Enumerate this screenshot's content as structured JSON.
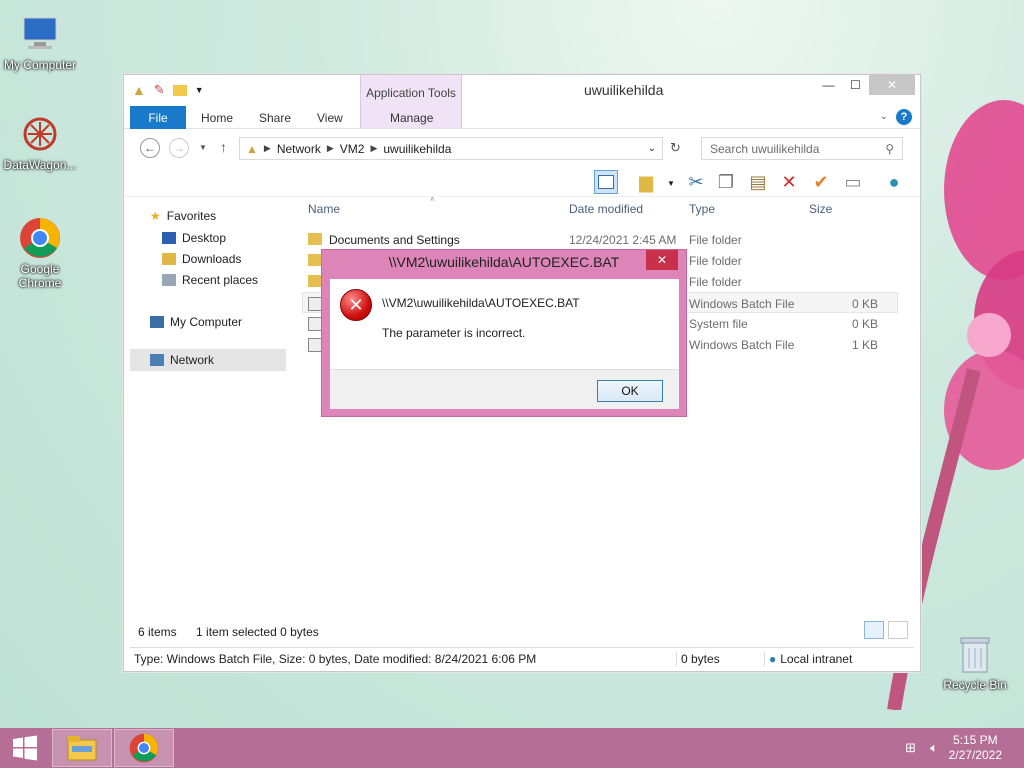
{
  "desktop": {
    "icons": [
      {
        "label": "My Computer"
      },
      {
        "label": "DataWagon..."
      },
      {
        "label": "Google Chrome"
      },
      {
        "label": "Recycle Bin"
      }
    ]
  },
  "window": {
    "title": "uwuilikehilda",
    "app_tools_label": "Application Tools",
    "tabs": {
      "file": "File",
      "home": "Home",
      "share": "Share",
      "view": "View",
      "manage": "Manage"
    },
    "address": {
      "crumbs": [
        "Network",
        "VM2",
        "uwuilikehilda"
      ]
    },
    "search_placeholder": "Search uwuilikehilda",
    "nav": {
      "favorites": "Favorites",
      "desktop": "Desktop",
      "downloads": "Downloads",
      "recent": "Recent places",
      "my_computer": "My Computer",
      "network": "Network"
    },
    "columns": {
      "name": "Name",
      "date": "Date modified",
      "type": "Type",
      "size": "Size"
    },
    "rows": [
      {
        "name": "Documents and Settings",
        "date": "12/24/2021 2:45 AM",
        "type": "File folder",
        "size": ""
      },
      {
        "name": "",
        "date": "",
        "type": "File folder",
        "size": ""
      },
      {
        "name": "",
        "date": "",
        "type": "File folder",
        "size": ""
      },
      {
        "name": "",
        "date": "",
        "type": "Windows Batch File",
        "size": "0 KB"
      },
      {
        "name": "",
        "date": "",
        "type": "System file",
        "size": "0 KB"
      },
      {
        "name": "",
        "date": "",
        "type": "Windows Batch File",
        "size": "1 KB"
      }
    ],
    "status": {
      "items": "6 items",
      "selected": "1 item selected  0 bytes"
    },
    "details": {
      "info": "Type: Windows Batch File, Size: 0 bytes, Date modified: 8/24/2021 6:06 PM",
      "size": "0 bytes",
      "zone": "Local intranet"
    }
  },
  "dialog": {
    "title": "\\\\VM2\\uwuilikehilda\\AUTOEXEC.BAT",
    "path": "\\\\VM2\\uwuilikehilda\\AUTOEXEC.BAT",
    "message": "The parameter is incorrect.",
    "ok": "OK"
  },
  "taskbar": {
    "time": "5:15 PM",
    "date": "2/27/2022"
  }
}
